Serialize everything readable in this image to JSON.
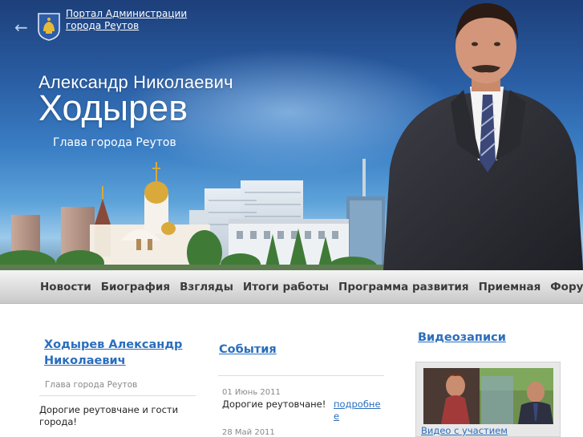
{
  "header": {
    "back_icon": "arrow-left-icon",
    "crest_icon": "city-crest-icon",
    "portal_link_line1": "Портал Администрации",
    "portal_link_line2": "города Реутов",
    "name_line1": "Александр Николаевич",
    "name_line2": "Ходырев",
    "title": "Глава города Реутов"
  },
  "nav": {
    "items": [
      {
        "label": "Новости"
      },
      {
        "label": "Биография"
      },
      {
        "label": "Взгляды"
      },
      {
        "label": "Итоги работы"
      },
      {
        "label": "Программа развития"
      },
      {
        "label": "Приемная"
      },
      {
        "label": "Форум"
      }
    ]
  },
  "left": {
    "heading_line1": "Ходырев Александр",
    "heading_line2": "Николаевич",
    "subtitle": "Глава города Реутов",
    "text_line1": "Дорогие реутовчане и гости",
    "text_line2": "города!"
  },
  "middle": {
    "heading": "События",
    "events": [
      {
        "date": "01 Июнь 2011",
        "title": "Дорогие реутовчане!",
        "more": "подробнее"
      },
      {
        "date": "28 Май 2011"
      }
    ]
  },
  "right": {
    "heading": "Видеозаписи",
    "video_caption": "Видео с участием"
  },
  "colors": {
    "link": "#2a6ebd",
    "header_blue": "#2a5ea4",
    "nav_text": "#3b3b3b"
  }
}
